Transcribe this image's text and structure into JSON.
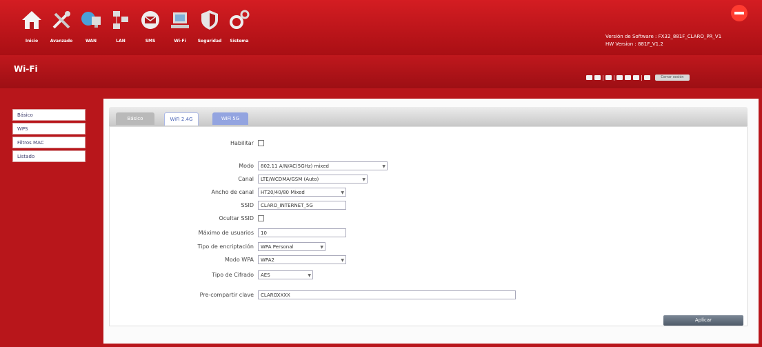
{
  "nav": [
    {
      "label": "Inicio",
      "icon": "home-icon"
    },
    {
      "label": "Avanzado",
      "icon": "tools-icon"
    },
    {
      "label": "WAN",
      "icon": "wan-icon"
    },
    {
      "label": "LAN",
      "icon": "lan-icon"
    },
    {
      "label": "SMS",
      "icon": "sms-icon"
    },
    {
      "label": "Wi-Fi",
      "icon": "wifi-icon"
    },
    {
      "label": "Seguridad",
      "icon": "shield-icon"
    },
    {
      "label": "Sistema",
      "icon": "gear-icon"
    }
  ],
  "header": {
    "version_line1": "Versión de Software : FX32_881F_CLARO_PR_V1",
    "version_line2": "HW Version : 881F_V1.2",
    "brand_color": "#e8141b"
  },
  "page": {
    "title": "Wi-Fi"
  },
  "toolbar": {
    "logout_label": "Cerrar sesión"
  },
  "sidebar": {
    "items": [
      {
        "label": "Básico"
      },
      {
        "label": "WPS"
      },
      {
        "label": "Filtros MAC"
      },
      {
        "label": "Listado"
      }
    ]
  },
  "tabs": [
    {
      "label": "Básico"
    },
    {
      "label": "WiFi 2.4G"
    },
    {
      "label": "WiFi 5G"
    }
  ],
  "form": {
    "enable_label": "Habilitar",
    "mode_label": "Modo",
    "mode_value": "802.11 A/N/AC(5GHz) mixed",
    "channel_label": "Canal",
    "channel_value": "LTE/WCDMA/GSM (Auto)",
    "bandwidth_label": "Ancho de canal",
    "bandwidth_value": "HT20/40/80 Mixed",
    "ssid_label": "SSID",
    "ssid_value": "CLARO_INTERNET_5G",
    "hide_ssid_label": "Ocultar SSID",
    "max_users_label": "Máximo de usuarios",
    "max_users_value": "10",
    "encryption_label": "Tipo de encriptación",
    "encryption_value": "WPA Personal",
    "wpa_mode_label": "Modo WPA",
    "wpa_mode_value": "WPA2",
    "cipher_label": "Tipo de Cifrado",
    "cipher_value": "AES",
    "psk_label": "Pre-compartir clave",
    "psk_value": "CLAROXXXX"
  },
  "buttons": {
    "apply_label": "Aplicar"
  }
}
